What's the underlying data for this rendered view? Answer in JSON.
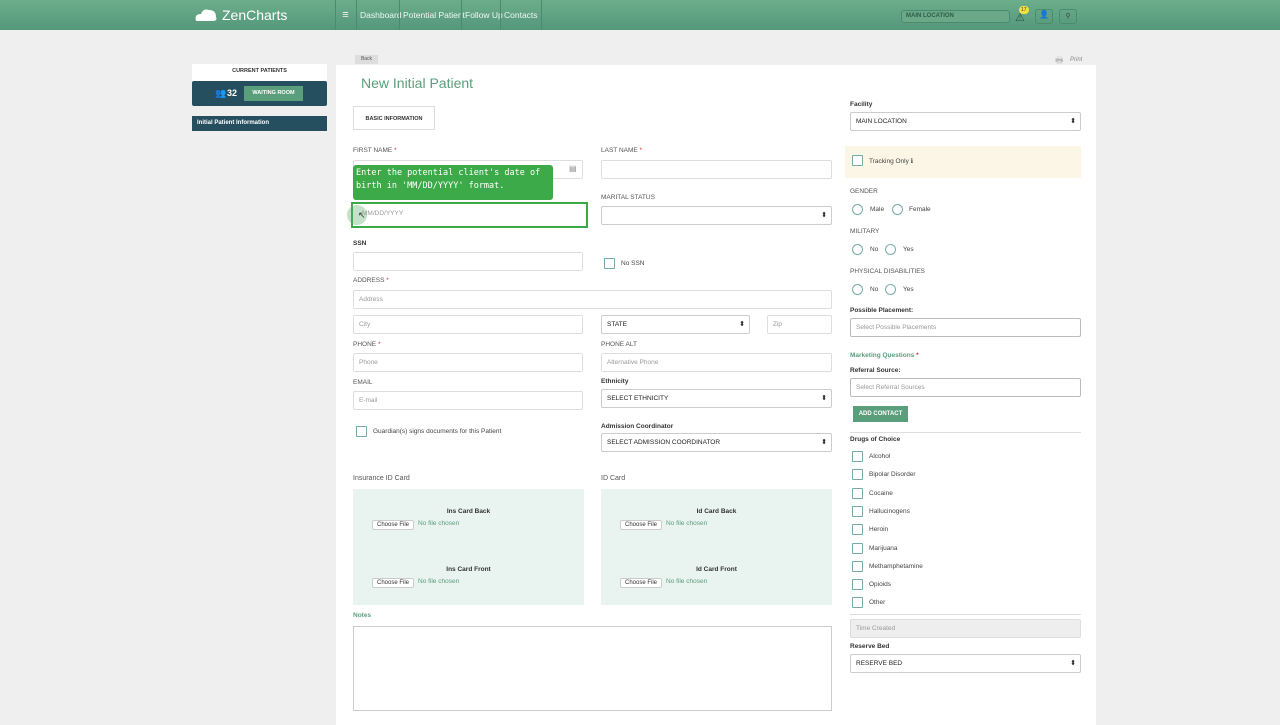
{
  "header": {
    "logo": "ZenCharts",
    "nav": [
      "Dashboard",
      "Potential Patient",
      "Follow Up",
      "Contacts"
    ],
    "location": "MAIN LOCATION",
    "alert_count": "17"
  },
  "sidebar": {
    "current_patients": "CURRENT PATIENTS",
    "count": "32",
    "waiting_room": "WAITING ROOM",
    "item": "Initial Patient Information"
  },
  "page": {
    "back": "Back",
    "print": "Print",
    "title": "New Initial Patient",
    "tab": "BASIC INFORMATION"
  },
  "form": {
    "first_name": "FIRST NAME",
    "last_name": "LAST NAME",
    "req": "*",
    "tooltip": "Enter the potential client's date of birth in 'MM/DD/YYYY' format.",
    "dob_placeholder": "MM/DD/YYYY",
    "marital_status": "MARITAL STATUS",
    "ssn": "SSN",
    "no_ssn": "No SSN",
    "address": "ADDRESS",
    "address_ph": "Address",
    "city_ph": "City",
    "state": "STATE",
    "zip_ph": "Zip",
    "phone": "PHONE",
    "phone_ph": "Phone",
    "phone_alt": "PHONE ALT",
    "phone_alt_ph": "Alternative Phone",
    "email": "EMAIL",
    "email_ph": "E-mail",
    "ethnicity": "Ethnicity",
    "ethnicity_val": "SELECT ETHNICITY",
    "guardian": "Guardian(s) signs documents for this Patient",
    "admission": "Admission Coordinator",
    "admission_val": "SELECT ADMISSION COORDINATOR",
    "ins_card": "Insurance ID Card",
    "id_card": "ID Card",
    "ins_back": "Ins Card Back",
    "ins_front": "Ins Card Front",
    "id_back": "Id Card Back",
    "id_front": "Id Card Front",
    "choose_file": "Choose File",
    "no_file": "No file chosen",
    "notes": "Notes"
  },
  "right": {
    "facility": "Facility",
    "facility_val": "MAIN LOCATION",
    "tracking": "Tracking Only",
    "gender": "GENDER",
    "male": "Male",
    "female": "Female",
    "military": "MILITARY",
    "no": "No",
    "yes": "Yes",
    "disabilities": "PHYSICAL DISABILITIES",
    "placement": "Possible Placement:",
    "placement_ph": "Select Possible Placements",
    "marketing": "Marketing Questions",
    "referral": "Referral Source:",
    "referral_ph": "Select Referral Sources",
    "add_contact": "ADD CONTACT",
    "drugs": "Drugs of Choice",
    "drug_list": [
      "Alcohol",
      "Bipolar Disorder",
      "Cocaine",
      "Hallucinogens",
      "Heroin",
      "Marijuana",
      "Methamphetamine",
      "Opioids",
      "Other"
    ],
    "time_created": "Time Created",
    "reserve_bed": "Reserve Bed",
    "reserve_val": "RESERVE BED"
  }
}
